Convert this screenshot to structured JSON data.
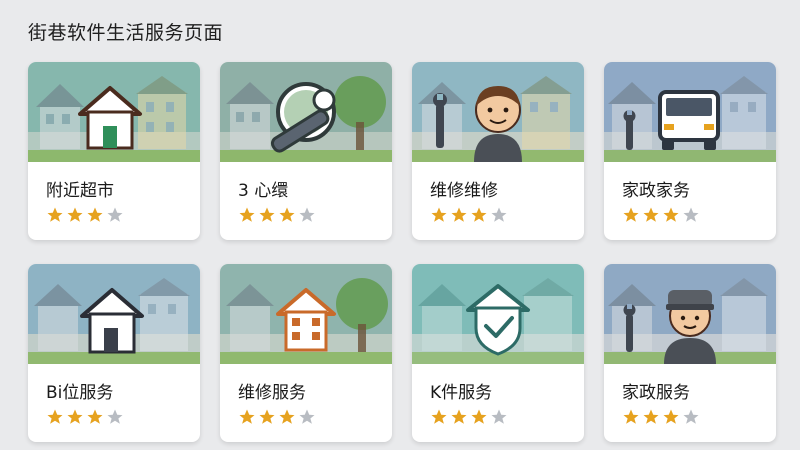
{
  "page": {
    "title": "街巷软件生活服务页面"
  },
  "colors": {
    "sky_teal": "#7fb3a8",
    "sky_blue": "#8fb1c8",
    "star_filled": "#e6a21f",
    "star_empty": "#b8bcc2",
    "grass": "#7eb04a"
  },
  "cards": [
    {
      "label": "附近超市",
      "icon": "house-icon",
      "rating": 3,
      "max": 4
    },
    {
      "label": "3 心缳",
      "icon": "wrench-icon",
      "rating": 3,
      "max": 4
    },
    {
      "label": "维修维修",
      "icon": "person-icon",
      "rating": 3,
      "max": 4
    },
    {
      "label": "家政家务",
      "icon": "van-icon",
      "rating": 3,
      "max": 4
    },
    {
      "label": "Bi位服务",
      "icon": "house-icon",
      "rating": 3,
      "max": 4
    },
    {
      "label": "维修服务",
      "icon": "building-icon",
      "rating": 3,
      "max": 4
    },
    {
      "label": "K件服务",
      "icon": "shield-check-icon",
      "rating": 3,
      "max": 4
    },
    {
      "label": "家政服务",
      "icon": "worker-icon",
      "rating": 3,
      "max": 4
    }
  ]
}
